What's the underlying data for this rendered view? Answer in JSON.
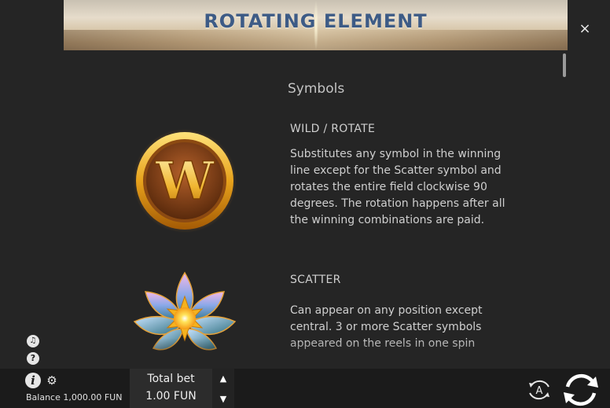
{
  "banner": {
    "title": "ROTATING ELEMENT"
  },
  "close": {
    "label": "×"
  },
  "section": {
    "title": "Symbols"
  },
  "symbols": [
    {
      "name": "WILD / ROTATE",
      "description": "Substitutes any symbol in the winning line except for the Scatter symbol and rotates the entire field clockwise 90 degrees. The rotation happens after all the winning combinations are paid.",
      "icon": "wild-w-coin-icon"
    },
    {
      "name": "SCATTER",
      "description": "Can appear on any position except central. 3 or more Scatter symbols appeared on the reels in one spin",
      "icon": "lotus-flower-icon"
    }
  ],
  "footer": {
    "balance": "Balance 1,000.00 FUN",
    "bet_label": "Total bet",
    "bet_value": "1.00 FUN",
    "up_arrow": "▲",
    "down_arrow": "▼",
    "info_glyph": "i",
    "gear_glyph": "⚙",
    "help_glyph": "?",
    "sound_glyph": "♫",
    "auto_label": "A"
  },
  "colors": {
    "background": "#252525",
    "bottombar": "#1b1b1b",
    "banner_title": "#3d5b86",
    "text": "#cfcfcf"
  }
}
